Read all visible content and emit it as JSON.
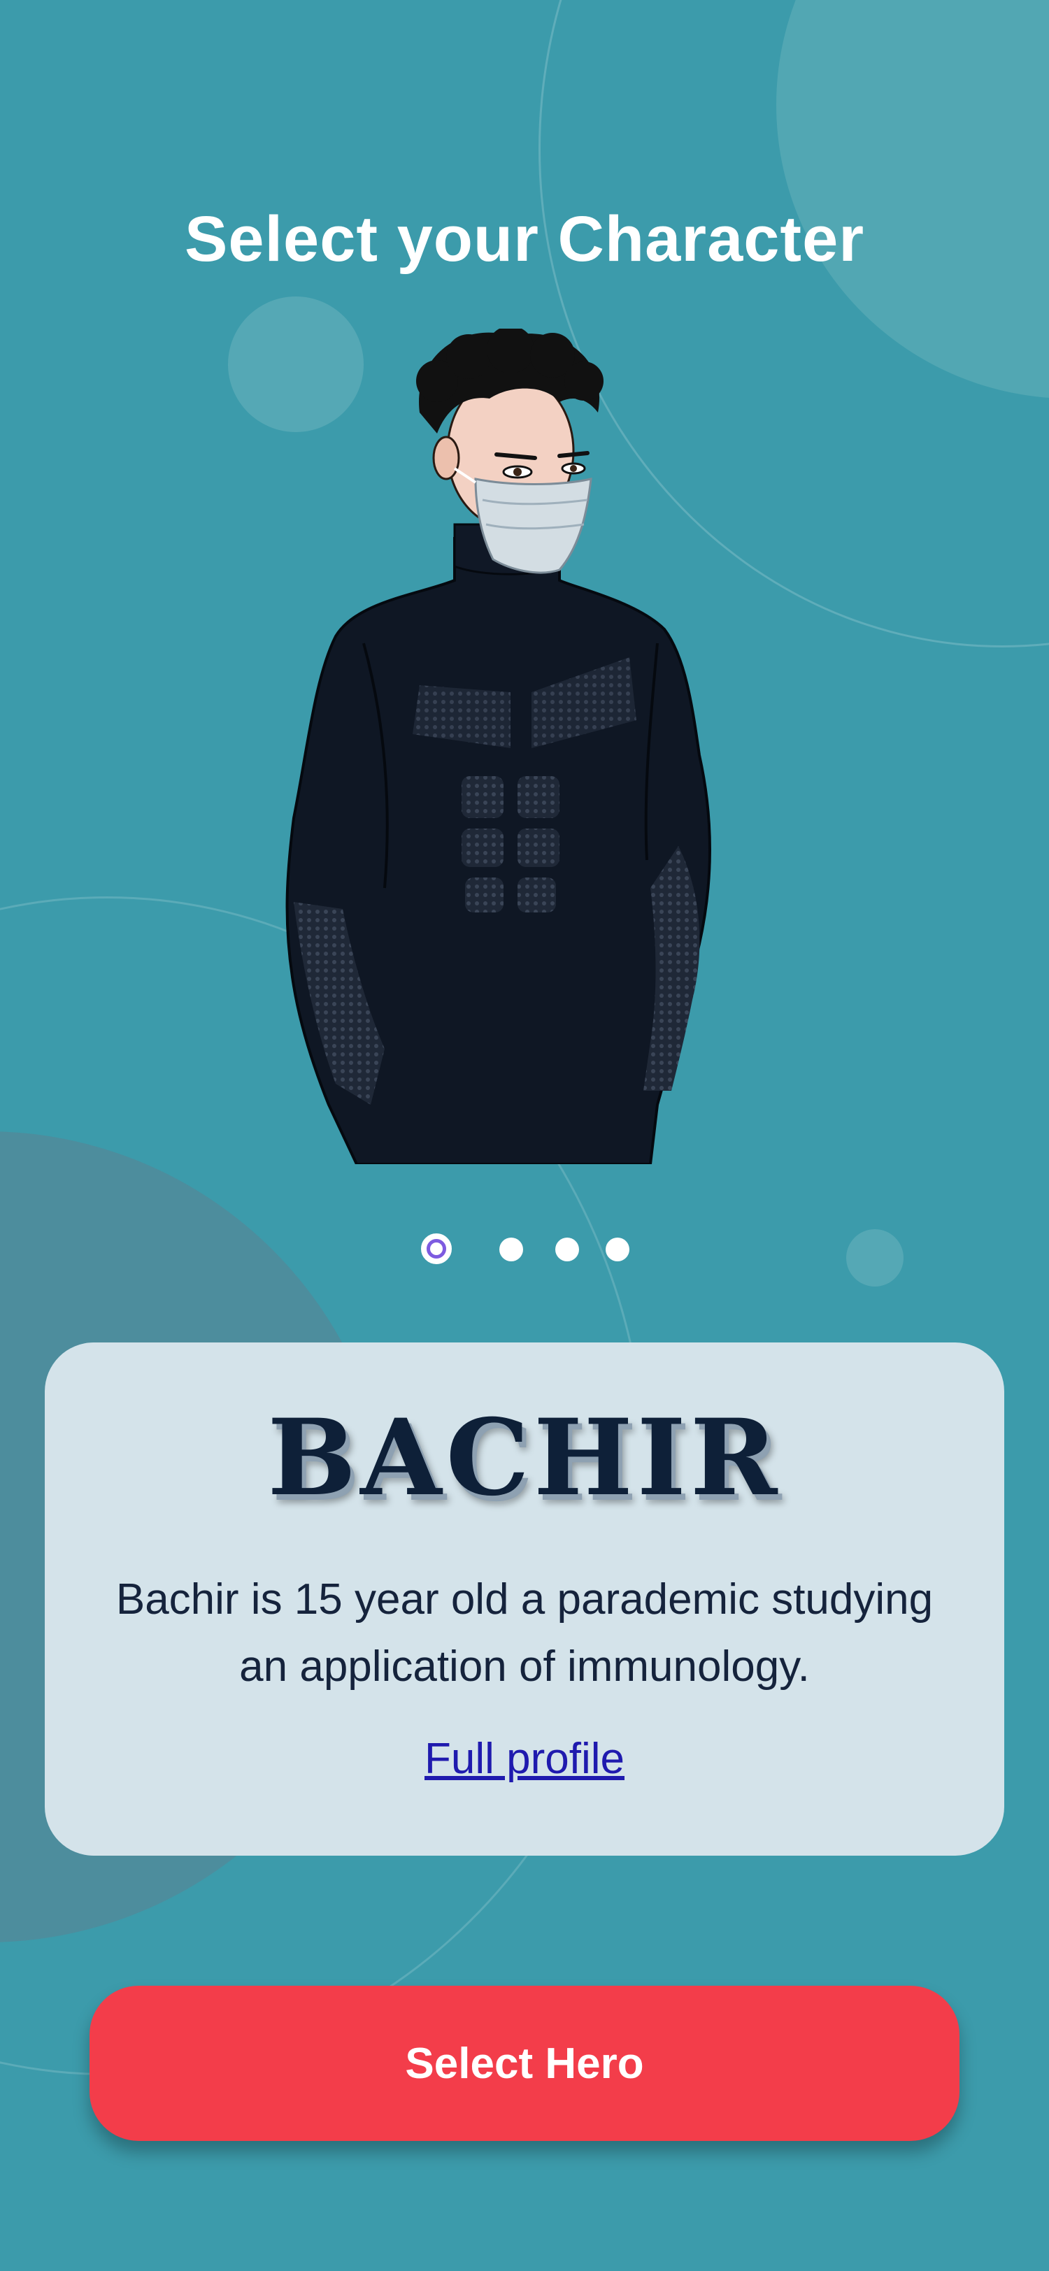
{
  "screen": {
    "title": "Select your Character"
  },
  "carousel": {
    "current_page": 1,
    "total_pages": 4,
    "hero_image_icon": "masked-hero-illustration"
  },
  "hero_card": {
    "name": "BACHIR",
    "description": "Bachir is 15 year old a parademic studying an application of immunology.",
    "profile_link": "Full profile"
  },
  "actions": {
    "select_label": "Select Hero"
  },
  "colors": {
    "background": "#3c9bab",
    "card": "#d4e3ea",
    "button": "#f33d4a",
    "active_dot": "#7d5be0",
    "link": "#1f1aae"
  }
}
